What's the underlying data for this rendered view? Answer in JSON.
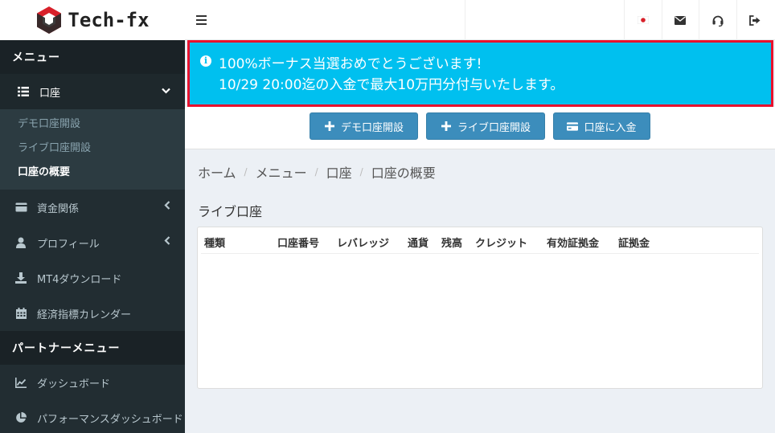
{
  "logo": {
    "text": "Tech-fx"
  },
  "sidebar": {
    "menu_header": "メニュー",
    "account": {
      "label": "口座",
      "icon": "list-icon"
    },
    "account_sub": [
      "デモ口座開設",
      "ライブ口座開設",
      "口座の概要"
    ],
    "items": [
      {
        "label": "資金関係",
        "icon": "money-icon"
      },
      {
        "label": "プロフィール",
        "icon": "user-icon"
      },
      {
        "label": "MT4ダウンロード",
        "icon": "download-icon"
      },
      {
        "label": "経済指標カレンダー",
        "icon": "calendar-icon"
      }
    ],
    "partner_header": "パートナーメニュー",
    "partner_items": [
      {
        "label": "ダッシュボード",
        "icon": "chart-icon"
      },
      {
        "label": "パフォーマンスダッシュボード",
        "icon": "pie-chart-icon"
      }
    ]
  },
  "topbar": {
    "icons": [
      "japan-flag-icon",
      "envelope-icon",
      "headset-icon",
      "sign-out-icon"
    ]
  },
  "alert": {
    "line1": "100%ボーナス当選おめでとうございます!",
    "line2": "10/29 20:00迄の入金で最大10万円分付与いたします。"
  },
  "actions": {
    "demo": "デモ口座開設",
    "live": "ライブ口座開設",
    "deposit": "口座に入金"
  },
  "breadcrumb": [
    "ホーム",
    "メニュー",
    "口座",
    "口座の概要"
  ],
  "section_title": "ライブ口座",
  "table": {
    "headers": [
      "種類",
      "口座番号",
      "レバレッジ",
      "通貨",
      "残高",
      "クレジット",
      "有効証拠金",
      "証拠金"
    ]
  },
  "colors": {
    "sidebar": "#222d32",
    "primary": "#3c8dbc",
    "alert": "#00c0ef",
    "highlight": "#e8112d"
  }
}
